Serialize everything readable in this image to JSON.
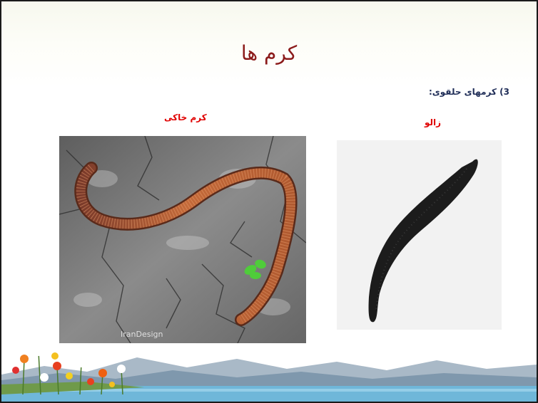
{
  "slide": {
    "title": "کرم ها",
    "subheading": "3) کرمهای حلقوی:",
    "left_caption": "کرم خاکی",
    "right_caption": "زالو",
    "watermark": "IranDesign",
    "left_image": "earthworm-photo",
    "right_image": "leech-photo",
    "footer_image": "flowers-mountains-lake-banner"
  },
  "colors": {
    "title": "#8b1a1a",
    "caption": "#e00000",
    "subheading": "#1f2d57"
  }
}
